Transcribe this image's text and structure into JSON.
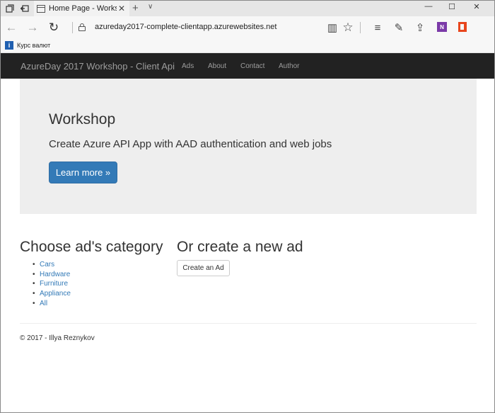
{
  "browser": {
    "tab": {
      "title": "Home Page - Workshop",
      "close_glyph": "✕"
    },
    "new_tab_glyph": "+",
    "tab_list_glyph": "∨",
    "window_controls": {
      "minimize": "—",
      "maximize": "☐",
      "close": "✕"
    },
    "nav": {
      "back": "←",
      "forward": "→",
      "refresh": "↻"
    },
    "url": "azureday2017-complete-clientapp.azurewebsites.net",
    "toolbar": {
      "reading_view": "▥",
      "favorite": "☆",
      "hub": "≡",
      "notes": "✎",
      "share": "⇪",
      "onenote_letter": "N"
    },
    "favorites": [
      {
        "icon_letter": "i",
        "label": "Курс валют"
      }
    ]
  },
  "site": {
    "brand": "AzureDay 2017 Workshop - Client Api",
    "nav_links": [
      "Ads",
      "About",
      "Contact",
      "Author"
    ],
    "jumbotron": {
      "title": "Workshop",
      "lead": "Create Azure API App with AAD authentication and web jobs",
      "button": "Learn more »"
    },
    "categories": {
      "title": "Choose ad's category",
      "bullet": "•",
      "items": [
        "Cars",
        "Hardware",
        "Furniture",
        "Appliance",
        "All"
      ]
    },
    "create": {
      "title": "Or create a new ad",
      "button": "Create an Ad"
    },
    "footer": "© 2017 - Illya Reznykov"
  },
  "colors": {
    "navbar_bg": "#222222",
    "navbar_text": "#9d9d9d",
    "jumbotron_bg": "#eeeeee",
    "primary": "#337ab7",
    "link": "#337ab7"
  }
}
